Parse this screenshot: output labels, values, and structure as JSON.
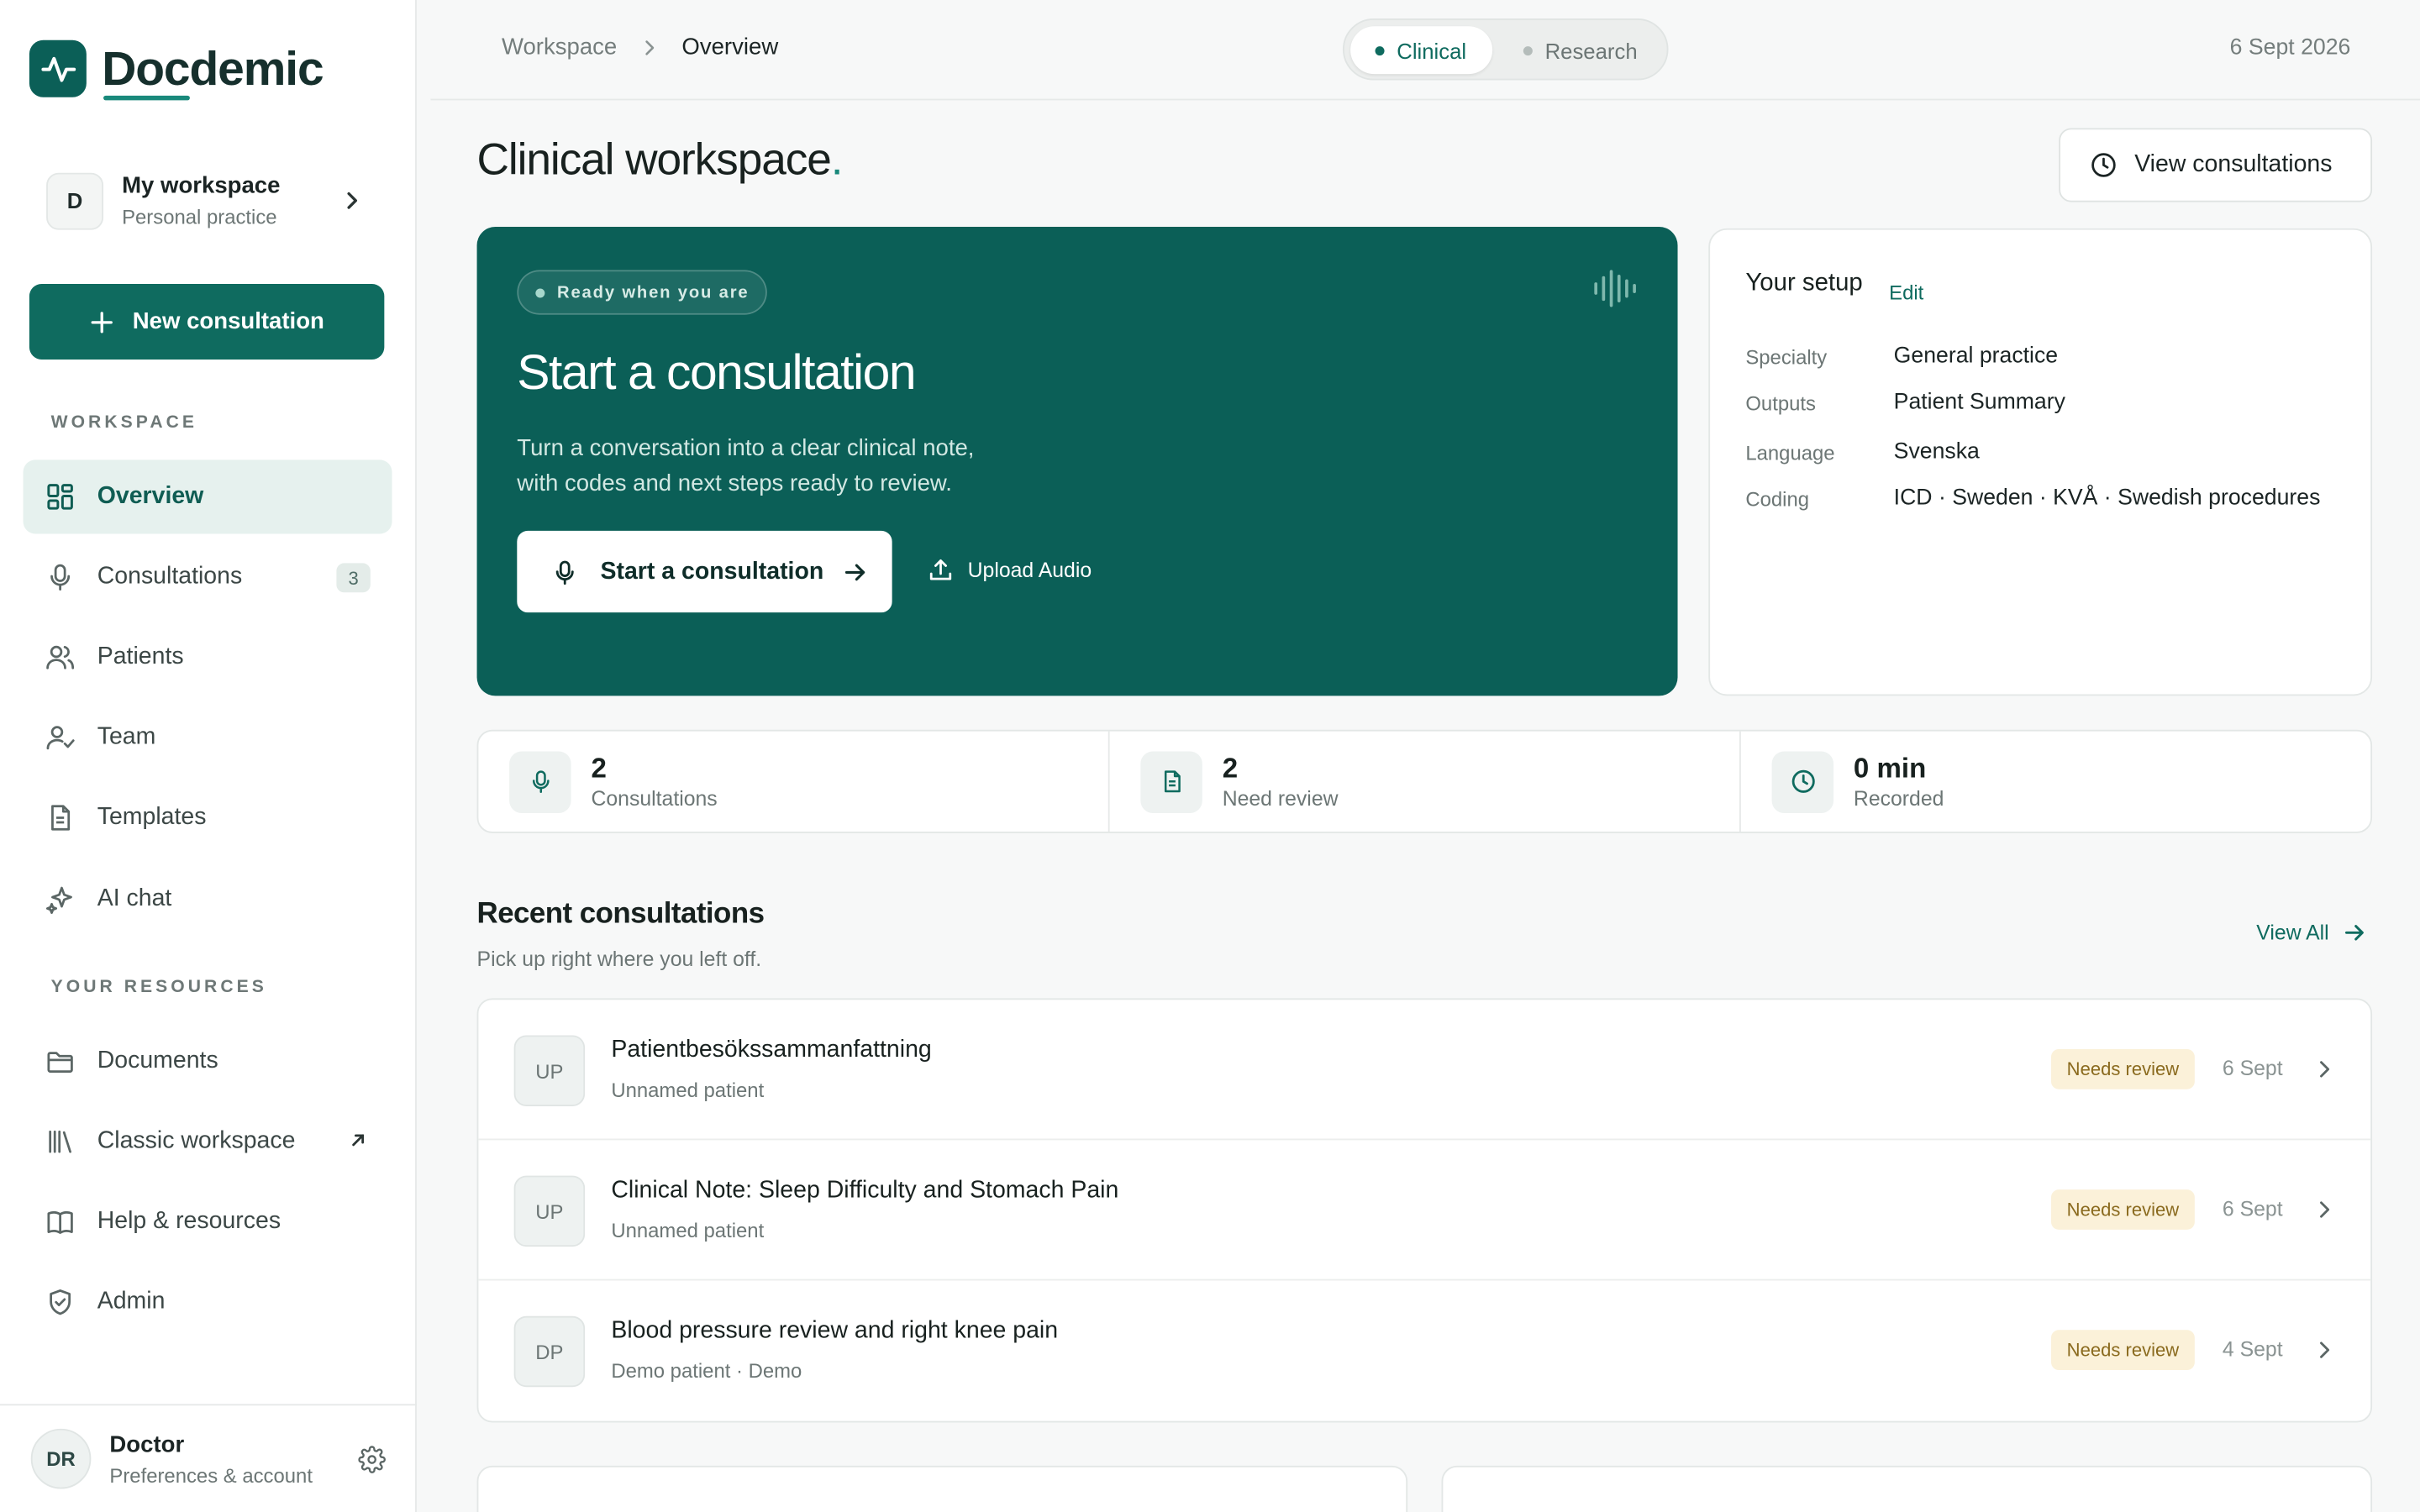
{
  "brand": {
    "name": "Docdemic"
  },
  "workspace": {
    "avatar": "D",
    "title": "My workspace",
    "subtitle": "Personal practice"
  },
  "new_consultation_label": "New consultation",
  "sidebar": {
    "workspace_label": "WORKSPACE",
    "resources_label": "YOUR RESOURCES",
    "items": [
      {
        "label": "Overview",
        "icon": "grid-icon"
      },
      {
        "label": "Consultations",
        "icon": "mic-icon",
        "badge": "3"
      },
      {
        "label": "Patients",
        "icon": "users-icon"
      },
      {
        "label": "Team",
        "icon": "user-check-icon"
      },
      {
        "label": "Templates",
        "icon": "file-icon"
      },
      {
        "label": "AI chat",
        "icon": "sparkles-icon"
      }
    ],
    "resources": [
      {
        "label": "Documents",
        "icon": "folder-icon"
      },
      {
        "label": "Classic workspace",
        "icon": "library-icon"
      },
      {
        "label": "Help & resources",
        "icon": "book-icon"
      },
      {
        "label": "Admin",
        "icon": "shield-icon"
      }
    ]
  },
  "user": {
    "avatar": "DR",
    "name": "Doctor",
    "subtitle": "Preferences & account"
  },
  "topbar": {
    "breadcrumb": [
      "Workspace",
      "Overview"
    ],
    "modes": [
      "Clinical",
      "Research"
    ],
    "active_mode": "Clinical",
    "date": "6 Sept 2026"
  },
  "page": {
    "title": "Clinical workspace",
    "title_dot": ".",
    "view_consultations_label": "View consultations"
  },
  "hero": {
    "pill": "Ready when you are",
    "title": "Start a consultation",
    "description_line1": "Turn a conversation into a clear clinical note,",
    "description_line2": "with codes and next steps ready to review.",
    "primary_label": "Start a consultation",
    "secondary_label": "Upload Audio"
  },
  "setup": {
    "title": "Your setup",
    "edit_label": "Edit",
    "rows": [
      {
        "key": "Specialty",
        "value": "General practice"
      },
      {
        "key": "Outputs",
        "value": "Patient Summary"
      },
      {
        "key": "Language",
        "value": "Svenska"
      },
      {
        "key": "Coding",
        "value": "ICD · Sweden · KVÅ · Swedish procedures"
      }
    ]
  },
  "stats": [
    {
      "value": "2",
      "label": "Consultations",
      "icon": "mic-icon"
    },
    {
      "value": "2",
      "label": "Need review",
      "icon": "document-icon"
    },
    {
      "value": "0 min",
      "label": "Recorded",
      "icon": "clock-icon"
    }
  ],
  "recent": {
    "title": "Recent consultations",
    "subtitle": "Pick up right where you left off.",
    "view_all_label": "View All",
    "rows": [
      {
        "avatar": "UP",
        "title": "Patientbesökssammanfattning",
        "subtitle": "Unnamed patient",
        "status": "Needs review",
        "date": "6 Sept"
      },
      {
        "avatar": "UP",
        "title": "Clinical Note: Sleep Difficulty and Stomach Pain",
        "subtitle": "Unnamed patient",
        "status": "Needs review",
        "date": "6 Sept"
      },
      {
        "avatar": "DP",
        "title": "Blood pressure review and right knee pain",
        "subtitle": "Demo patient · Demo",
        "status": "Needs review",
        "date": "4 Sept"
      }
    ]
  },
  "colors": {
    "brand": "#0b5f57",
    "accent": "#19897b",
    "badge_bg": "#fbf1d9",
    "badge_text": "#8a6a1e"
  }
}
